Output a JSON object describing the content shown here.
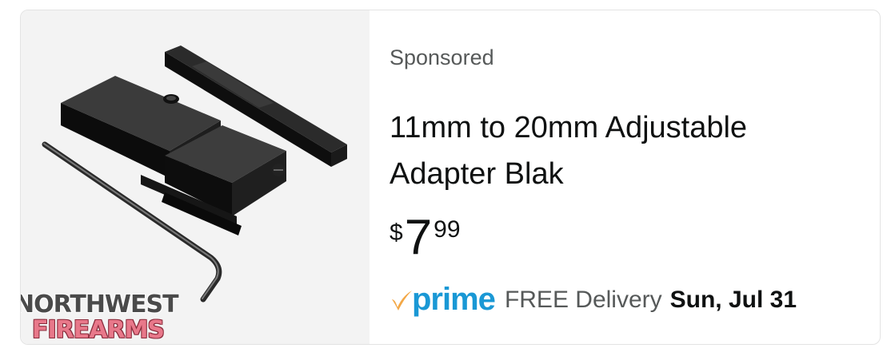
{
  "listing": {
    "sponsored_label": "Sponsored",
    "title": "11mm to 20mm Adjustable Adapter Blak",
    "price": {
      "symbol": "$",
      "whole": "7",
      "fraction": "99"
    },
    "delivery": {
      "prime_label": "prime",
      "free_label": "FREE Delivery",
      "date": "Sun, Jul 31"
    }
  },
  "watermark": {
    "line1": "NORTHWEST",
    "line2": "FIREARMS"
  },
  "colors": {
    "prime_blue": "#1a98d5",
    "prime_check": "#f3a847",
    "text_primary": "#0f1111",
    "text_secondary": "#565959",
    "watermark_pink": "#e8788a"
  },
  "icons": {
    "prime_check": "checkmark-swoosh-icon"
  }
}
